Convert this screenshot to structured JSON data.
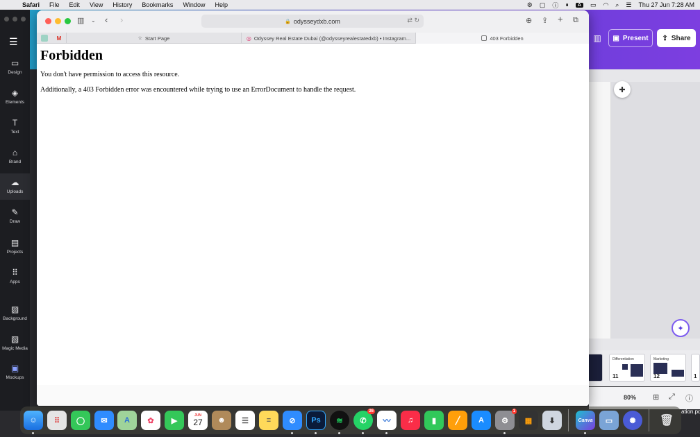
{
  "menubar": {
    "app": "Safari",
    "items": [
      "File",
      "Edit",
      "View",
      "History",
      "Bookmarks",
      "Window",
      "Help"
    ],
    "status_letter": "A",
    "clock": "Thu 27 Jun  7:28 AM"
  },
  "safari": {
    "address": "odysseydxb.com",
    "tabs": [
      {
        "label": "Start Page",
        "icon": "star-icon"
      },
      {
        "label": "Odyssey Real Estate Dubai (@odysseyrealestatedxb) • Instagram...",
        "icon": "instagram-icon"
      },
      {
        "label": "403 Forbidden",
        "icon": "page-icon"
      }
    ],
    "favorites": [
      {
        "icon": "favorite-tile-icon"
      },
      {
        "icon": "gmail-icon",
        "glyph": "M"
      }
    ]
  },
  "page": {
    "heading": "Forbidden",
    "line1": "You don't have permission to access this resource.",
    "line2": "Additionally, a 403 Forbidden error was encountered while trying to use an ErrorDocument to handle the request."
  },
  "canva": {
    "rail_items": [
      {
        "label": "Design",
        "icon": "design-icon"
      },
      {
        "label": "Elements",
        "icon": "elements-icon"
      },
      {
        "label": "Text",
        "icon": "text-icon"
      },
      {
        "label": "Brand",
        "icon": "brand-icon"
      },
      {
        "label": "Uploads",
        "icon": "uploads-icon"
      },
      {
        "label": "Draw",
        "icon": "draw-icon"
      },
      {
        "label": "Projects",
        "icon": "projects-icon"
      },
      {
        "label": "Apps",
        "icon": "apps-icon"
      },
      {
        "label": "Background",
        "icon": "background-icon"
      },
      {
        "label": "Magic Media",
        "icon": "magic-media-icon"
      },
      {
        "label": "Mockups",
        "icon": "mockups-icon"
      }
    ],
    "present_label": "Present",
    "share_label": "Share",
    "zoom": "80%",
    "thumbnails": [
      {
        "num": "",
        "title": ""
      },
      {
        "num": "11",
        "title": "Differentiation"
      },
      {
        "num": "12",
        "title": "Marketing"
      },
      {
        "num": "1",
        "title": ""
      }
    ]
  },
  "dock": {
    "apps": [
      "Finder",
      "Launchpad",
      "Messages",
      "Mail",
      "Maps",
      "Photos",
      "FaceTime",
      "Calendar",
      "Contacts",
      "Reminders",
      "Notes",
      "Safari",
      "Photoshop",
      "Spotify",
      "WhatsApp",
      "Freeform",
      "Music",
      "Numbers",
      "Pages",
      "App Store",
      "System Settings",
      "Calculator",
      "Downloads",
      "Canva",
      "Preview",
      "Perplexity",
      "Trash"
    ],
    "calendar_month": "JUN",
    "calendar_day": "27",
    "whatsapp_badge": "26",
    "settings_badge": "1",
    "desktop_file": "ation.pd"
  },
  "colors": {
    "canva_gradient_start": "#1ea7c8",
    "canva_gradient_end": "#7d3ee0",
    "close": "#ff5f57",
    "minimize": "#febc2e",
    "zoom": "#28c840"
  }
}
